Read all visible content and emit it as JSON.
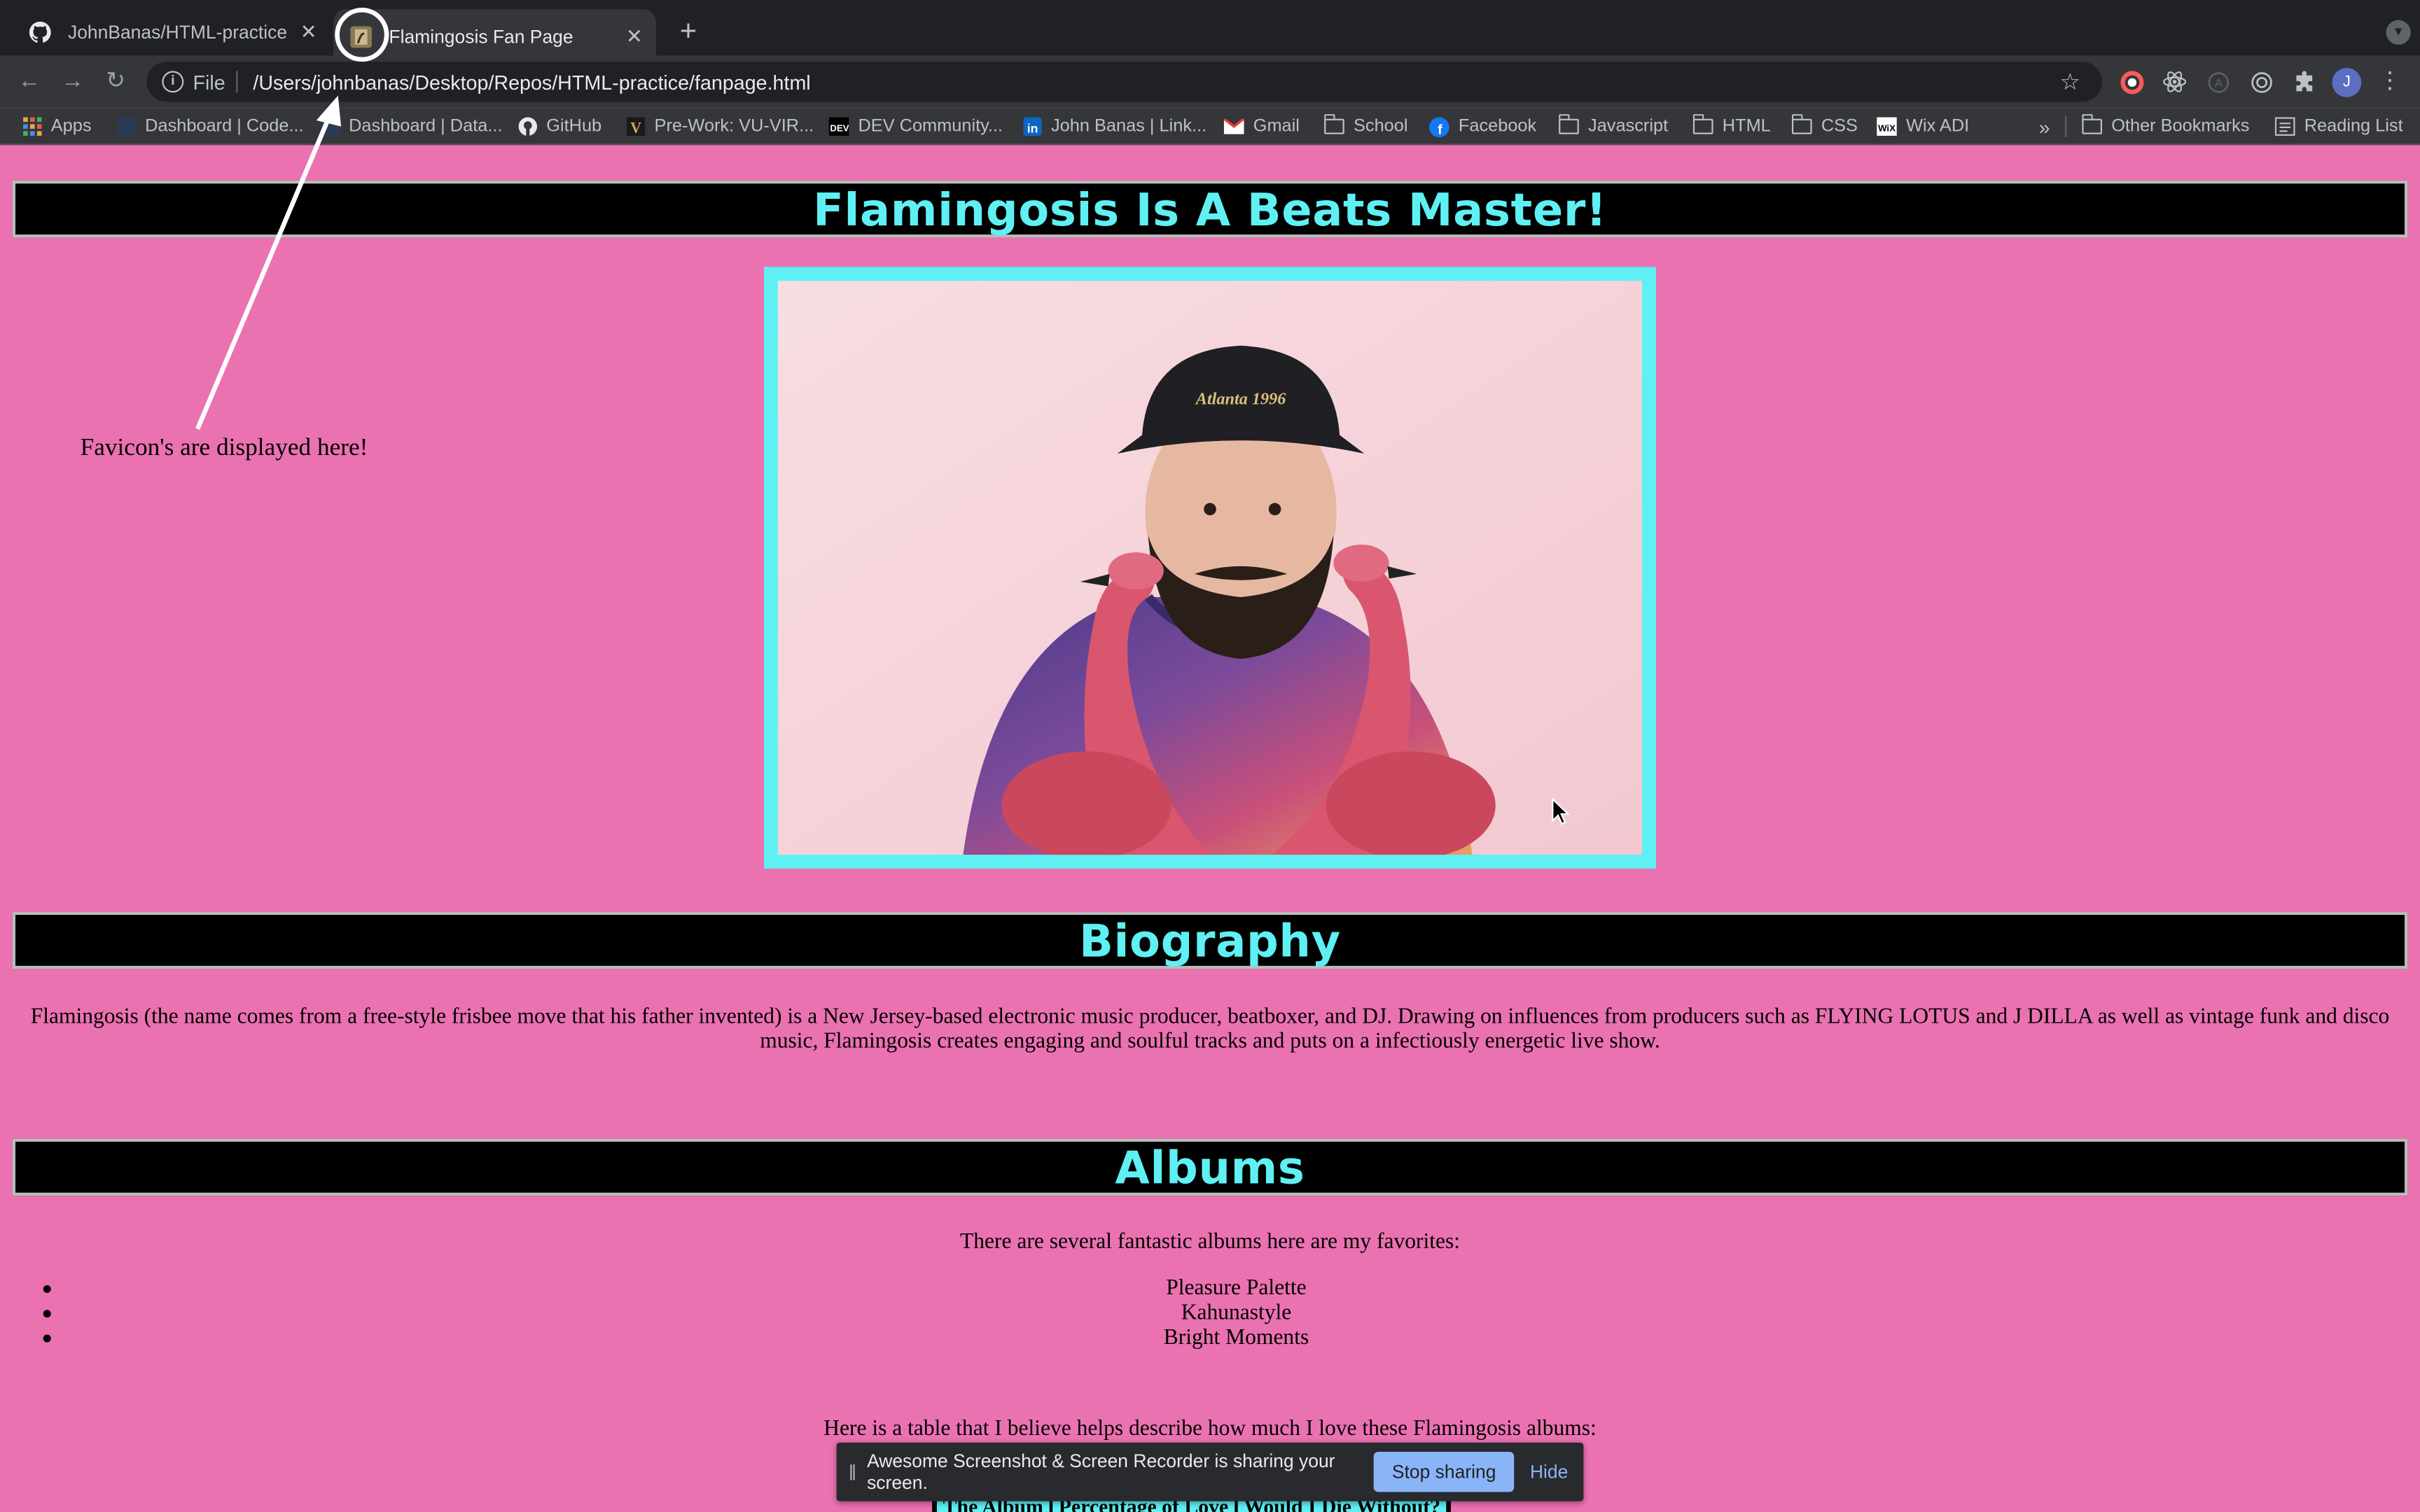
{
  "browser": {
    "tabs": [
      {
        "label": "JohnBanas/HTML-practice",
        "icon": "github-icon",
        "active": false
      },
      {
        "label": "Flamingosis Fan Page",
        "icon": "flamingo-favicon",
        "active": true
      }
    ],
    "address": {
      "scheme": "File",
      "url": "/Users/johnbanas/Desktop/Repos/HTML-practice/fanpage.html"
    },
    "profile_initial": "J",
    "bookmarks": [
      {
        "label": "Apps",
        "icon": "apps-grid-icon"
      },
      {
        "label": "Dashboard | Code...",
        "icon": "site-icon"
      },
      {
        "label": "Dashboard | Data...",
        "icon": "site-icon"
      },
      {
        "label": "GitHub",
        "icon": "github-icon"
      },
      {
        "label": "Pre-Work: VU-VIR...",
        "icon": "vanderbilt-icon"
      },
      {
        "label": "DEV Community...",
        "icon": "dev-icon"
      },
      {
        "label": "John Banas | Link...",
        "icon": "linkedin-icon"
      },
      {
        "label": "Gmail",
        "icon": "gmail-icon"
      },
      {
        "label": "School",
        "icon": "folder-icon"
      },
      {
        "label": "Facebook",
        "icon": "facebook-icon"
      },
      {
        "label": "Javascript",
        "icon": "folder-icon"
      },
      {
        "label": "HTML",
        "icon": "folder-icon"
      },
      {
        "label": "CSS",
        "icon": "folder-icon"
      },
      {
        "label": "Wix ADI",
        "icon": "wix-icon"
      }
    ],
    "bookmarks_overflow": "»",
    "other_bookmarks": "Other Bookmarks",
    "reading_list": "Reading List"
  },
  "page": {
    "title": "Flamingosis Is A Beats Master!",
    "image_alt": "Flamingosis holding two pink flamingo lawn ornaments",
    "bio_heading": "Biography",
    "bio_text": "Flamingosis (the name comes from a free-style frisbee move that his father invented) is a New Jersey-based electronic music producer, beatboxer, and DJ. Drawing on influences from producers such as FLYING LOTUS and J DILLA as well as vintage funk and disco music, Flamingosis creates engaging and soulful tracks and puts on a infectiously energetic live show.",
    "albums_heading": "Albums",
    "albums_intro": "There are several fantastic albums here are my favorites:",
    "albums": [
      "Pleasure Palette",
      "Kahunastyle",
      "Bright Moments"
    ],
    "table_intro": "Here is a table that I believe helps describe how much I love these Flamingosis albums:",
    "table_headers": [
      "The Album",
      "Percentage of Love",
      "Would I Die Without?"
    ]
  },
  "annotation": {
    "text": "Favicon's are displayed here!"
  },
  "sharing_bar": {
    "message": "Awesome Screenshot & Screen Recorder is sharing your screen.",
    "stop_label": "Stop sharing",
    "hide_label": "Hide"
  },
  "colors": {
    "page_bg": "#eb72b1",
    "accent_cyan": "#5ff0f4",
    "header_bg": "#000000"
  }
}
